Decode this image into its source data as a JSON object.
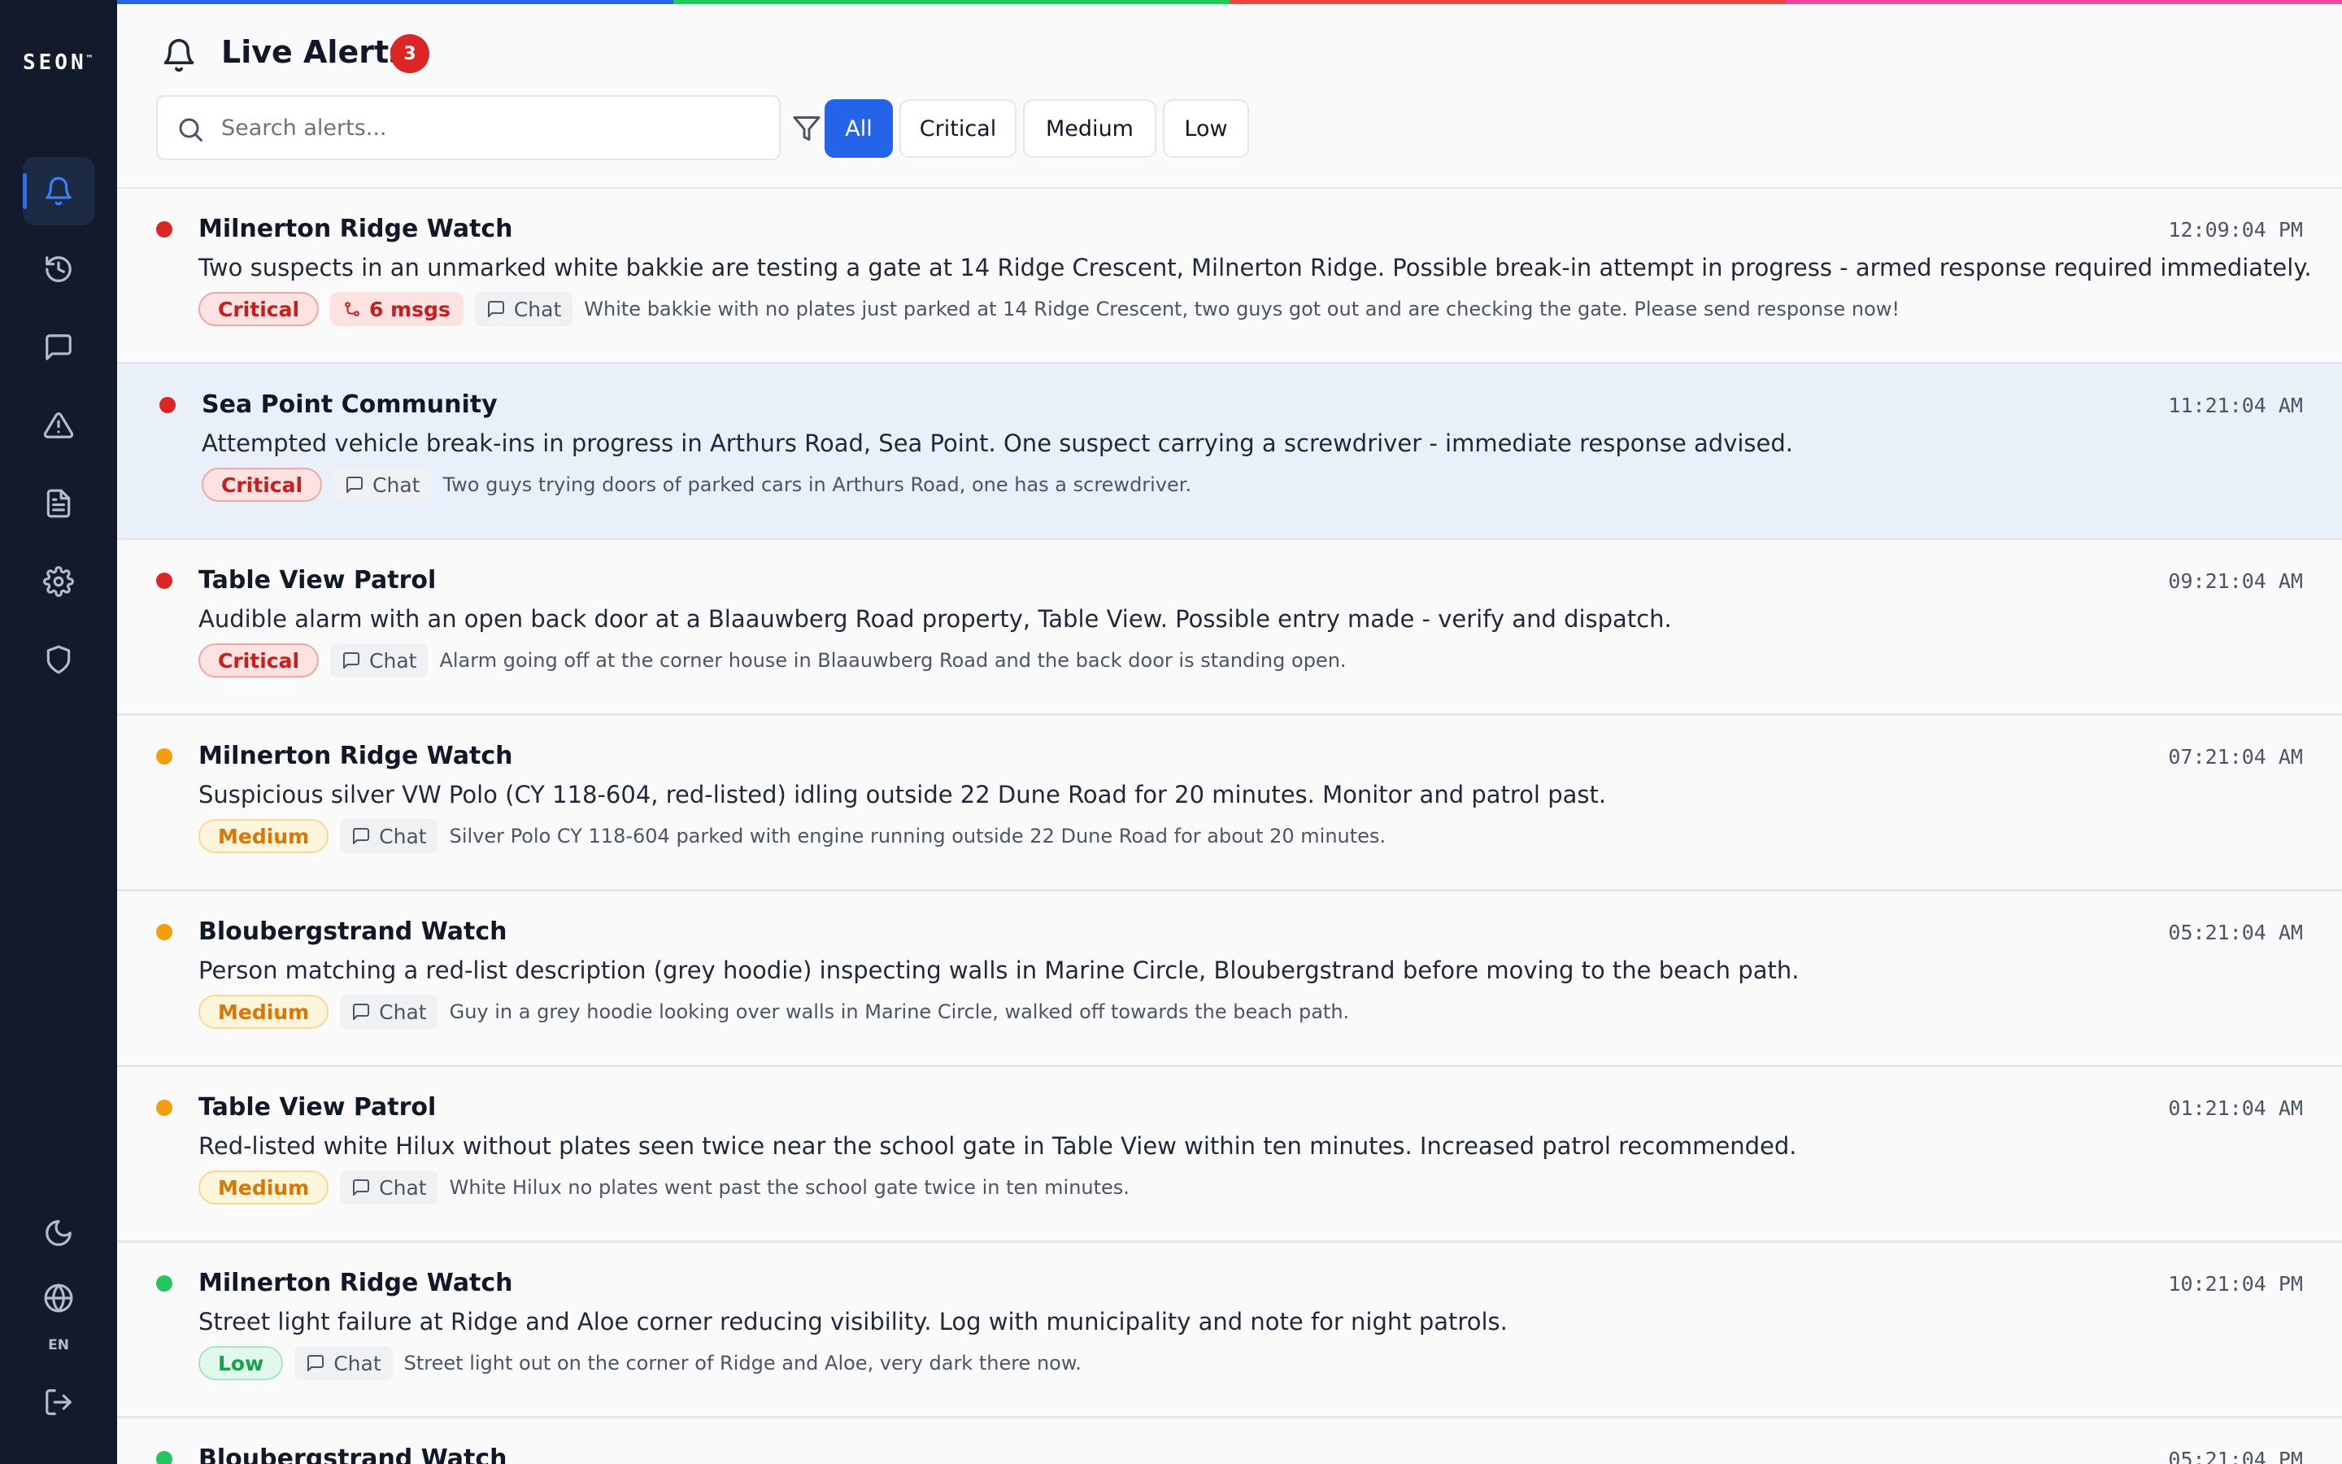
{
  "app": {
    "logo": "SEON",
    "logo_mark": "™",
    "language": "EN"
  },
  "sidebar": {
    "items": [
      {
        "name": "alerts",
        "icon": "bell-icon",
        "active": true
      },
      {
        "name": "history",
        "icon": "history-icon"
      },
      {
        "name": "chat",
        "icon": "chat-icon"
      },
      {
        "name": "incidents",
        "icon": "warning-icon"
      },
      {
        "name": "reports",
        "icon": "document-icon"
      },
      {
        "name": "settings",
        "icon": "gear-icon"
      },
      {
        "name": "security",
        "icon": "shield-icon"
      }
    ],
    "bottom": [
      {
        "name": "theme",
        "icon": "moon-icon"
      },
      {
        "name": "language",
        "icon": "globe-icon"
      },
      {
        "name": "logout",
        "icon": "logout-icon"
      }
    ]
  },
  "strip_colors": [
    "#2563eb",
    "#22c55e",
    "#ef4444",
    "#ec4899"
  ],
  "header": {
    "title": "Live Alerts",
    "count": "3"
  },
  "search": {
    "placeholder": "Search alerts...",
    "value": ""
  },
  "filters": {
    "all": "All",
    "critical": "Critical",
    "medium": "Medium",
    "low": "Low",
    "selected": "All"
  },
  "severity_colors": {
    "critical": "#dc2626",
    "medium": "#f59e0b",
    "low": "#22c55e"
  },
  "alerts": [
    {
      "group": "Milnerton Ridge Watch",
      "time": "12:09:04 PM",
      "description": "Two suspects in an unmarked white bakkie are testing a gate at 14 Ridge Crescent, Milnerton Ridge. Possible break-in attempt in progress - armed response required immediately.",
      "severity": "Critical",
      "messages": "6 msgs",
      "source": "Chat",
      "excerpt": "White bakkie with no plates just parked at 14 Ridge Crescent, two guys got out and are checking the gate. Please send response now!"
    },
    {
      "group": "Sea Point Community",
      "time": "11:21:04 AM",
      "description": "Attempted vehicle break-ins in progress in Arthurs Road, Sea Point. One suspect carrying a screwdriver - immediate response advised.",
      "severity": "Critical",
      "source": "Chat",
      "excerpt": "Two guys trying doors of parked cars in Arthurs Road, one has a screwdriver."
    },
    {
      "group": "Table View Patrol",
      "time": "09:21:04 AM",
      "description": "Audible alarm with an open back door at a Blaauwberg Road property, Table View. Possible entry made - verify and dispatch.",
      "severity": "Critical",
      "source": "Chat",
      "excerpt": "Alarm going off at the corner house in Blaauwberg Road and the back door is standing open."
    },
    {
      "group": "Milnerton Ridge Watch",
      "time": "07:21:04 AM",
      "description": "Suspicious silver VW Polo (CY 118-604, red-listed) idling outside 22 Dune Road for 20 minutes. Monitor and patrol past.",
      "severity": "Medium",
      "source": "Chat",
      "excerpt": "Silver Polo CY 118-604 parked with engine running outside 22 Dune Road for about 20 minutes."
    },
    {
      "group": "Bloubergstrand Watch",
      "time": "05:21:04 AM",
      "description": "Person matching a red-list description (grey hoodie) inspecting walls in Marine Circle, Bloubergstrand before moving to the beach path.",
      "severity": "Medium",
      "source": "Chat",
      "excerpt": "Guy in a grey hoodie looking over walls in Marine Circle, walked off towards the beach path."
    },
    {
      "group": "Table View Patrol",
      "time": "01:21:04 AM",
      "description": "Red-listed white Hilux without plates seen twice near the school gate in Table View within ten minutes. Increased patrol recommended.",
      "severity": "Medium",
      "source": "Chat",
      "excerpt": "White Hilux no plates went past the school gate twice in ten minutes."
    },
    {
      "group": "Milnerton Ridge Watch",
      "time": "10:21:04 PM",
      "description": "Street light failure at Ridge and Aloe corner reducing visibility. Log with municipality and note for night patrols.",
      "severity": "Low",
      "source": "Chat",
      "excerpt": "Street light out on the corner of Ridge and Aloe, very dark there now."
    },
    {
      "group": "Bloubergstrand Watch",
      "time": "05:21:04 PM",
      "severity": "Low"
    }
  ]
}
